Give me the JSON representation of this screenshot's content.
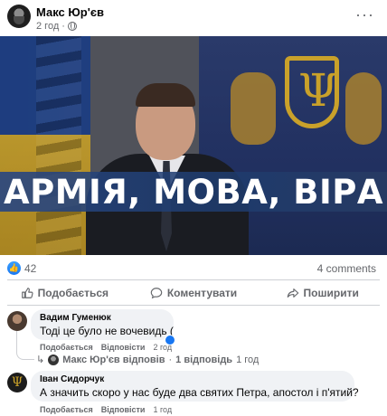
{
  "post": {
    "author": "Макс Юр'єв",
    "time": "2 год",
    "more": "···",
    "banner_text": "АРМІЯ, МОВА, ВІРА"
  },
  "stats": {
    "likes": "42",
    "comments": "4 comments"
  },
  "actions": {
    "like": "Подобається",
    "comment": "Коментувати",
    "share": "Поширити"
  },
  "comments": [
    {
      "name": "Вадим Гуменюк",
      "text": "Тоді це було не вочевидь (",
      "like": "Подобається",
      "reply": "Відповісти",
      "time": "2 год"
    },
    {
      "name": "Іван Сидорчук",
      "text": "А значить скоро у нас буде два святих Петра, апостол і п'ятий?",
      "like": "Подобається",
      "reply": "Відповісти",
      "time": "1 год"
    }
  ],
  "replies": {
    "author_text": "Макс Юр'єв відповів",
    "count_text": "1 відповідь",
    "time": "1 год"
  },
  "colors": {
    "accent": "#1877f2",
    "muted": "#65676b",
    "bubble": "#f0f2f5"
  }
}
